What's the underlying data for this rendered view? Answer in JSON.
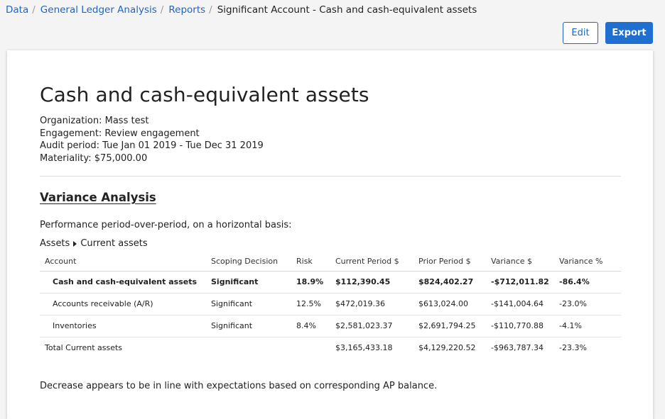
{
  "breadcrumb": {
    "items": [
      {
        "label": "Data",
        "link": true
      },
      {
        "label": "General Ledger Analysis",
        "link": true
      },
      {
        "label": "Reports",
        "link": true
      },
      {
        "label": "Significant Account - Cash and cash-equivalent assets",
        "link": false
      }
    ],
    "separator": "/"
  },
  "toolbar": {
    "edit_label": "Edit",
    "export_label": "Export"
  },
  "report": {
    "title": "Cash and cash-equivalent assets",
    "meta": {
      "organization": "Organization: Mass test",
      "engagement": "Engagement: Review engagement",
      "audit_period": "Audit period: Tue Jan 01 2019 - Tue Dec 31 2019",
      "materiality": "Materiality: $75,000.00"
    },
    "section_title": "Variance Analysis",
    "intro": "Performance period-over-period, on a horizontal basis:",
    "path": {
      "parent": "Assets",
      "child": "Current assets"
    },
    "table": {
      "columns": [
        "Account",
        "Scoping Decision",
        "Risk",
        "Current Period $",
        "Prior Period $",
        "Variance $",
        "Variance %"
      ],
      "rows": [
        {
          "account": "Cash and cash-equivalent assets",
          "scoping": "Significant",
          "risk": "18.9%",
          "current": "$112,390.45",
          "prior": "$824,402.27",
          "variance": "-$712,011.82",
          "variance_pct": "-86.4%"
        },
        {
          "account": "Accounts receivable (A/R)",
          "scoping": "Significant",
          "risk": "12.5%",
          "current": "$472,019.36",
          "prior": "$613,024.00",
          "variance": "-$141,004.64",
          "variance_pct": "-23.0%"
        },
        {
          "account": "Inventories",
          "scoping": "Significant",
          "risk": "8.4%",
          "current": "$2,581,023.37",
          "prior": "$2,691,794.25",
          "variance": "-$110,770.88",
          "variance_pct": "-4.1%"
        }
      ],
      "total": {
        "account": "Total Current assets",
        "current": "$3,165,433.18",
        "prior": "$4,129,220.52",
        "variance": "-$963,787.34",
        "variance_pct": "-23.3%"
      }
    },
    "note": "Decrease appears to be in line with expectations based on corresponding AP balance."
  },
  "colors": {
    "link": "#1f64c8",
    "primary_button": "#1f6fd1",
    "page_background": "#f4f4f4"
  }
}
